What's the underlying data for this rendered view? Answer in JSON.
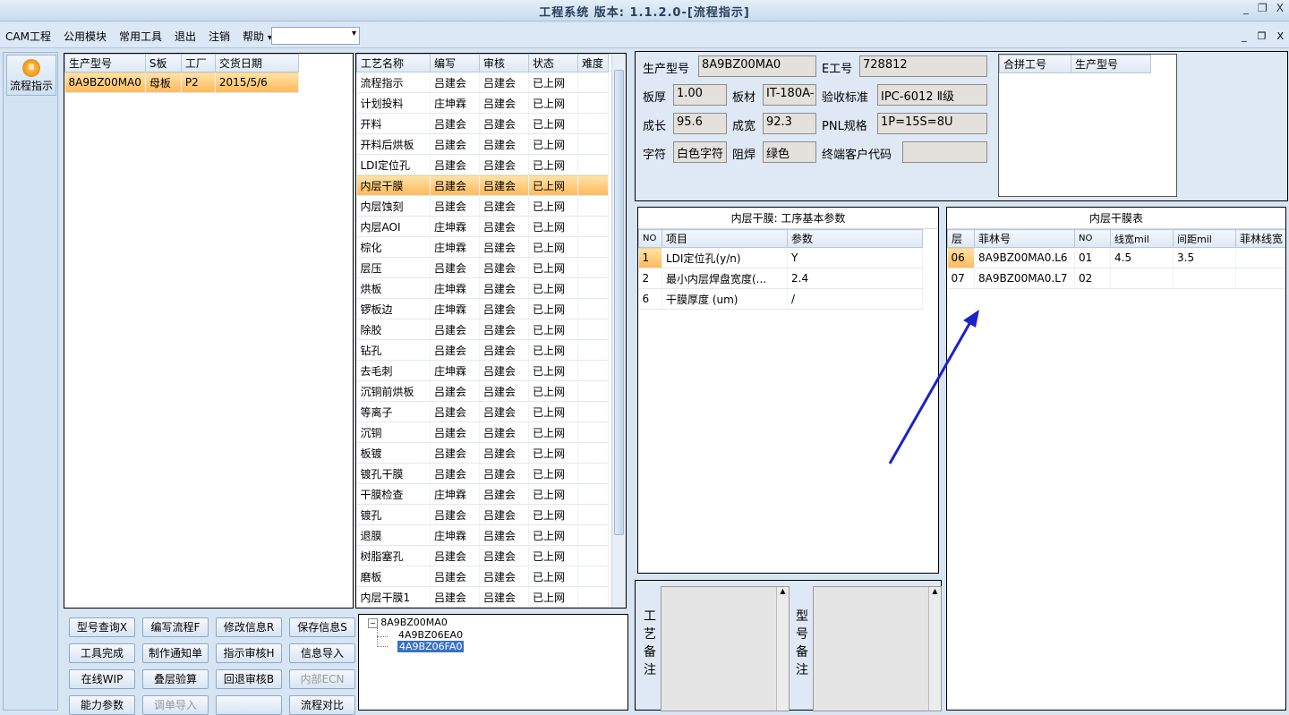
{
  "window": {
    "title": "工程系统 版本: 1.1.2.0-[流程指示]",
    "controls": [
      "_",
      "❐",
      "X"
    ]
  },
  "menu": {
    "items": [
      "CAM工程",
      "公用模块",
      "常用工具",
      "退出",
      "注销",
      "帮助"
    ],
    "help_arrow": "▾",
    "combo_value": ""
  },
  "child_controls": [
    "_",
    "❐",
    "X"
  ],
  "sidebar": {
    "flow_button": "流程指示"
  },
  "order_table": {
    "headers": [
      "生产型号",
      "S板",
      "工厂",
      "交货日期"
    ],
    "rows": [
      [
        "8A9BZ00MA0",
        "母板",
        "P2",
        "2015/5/6"
      ]
    ]
  },
  "process_table": {
    "headers": [
      "工艺名称",
      "编写",
      "审核",
      "状态",
      "难度"
    ],
    "rows": [
      [
        "流程指示",
        "吕建会",
        "吕建会",
        "已上网",
        ""
      ],
      [
        "计划投料",
        "庄坤霖",
        "吕建会",
        "已上网",
        ""
      ],
      [
        "开料",
        "吕建会",
        "吕建会",
        "已上网",
        ""
      ],
      [
        "开料后烘板",
        "吕建会",
        "吕建会",
        "已上网",
        ""
      ],
      [
        "LDI定位孔",
        "吕建会",
        "吕建会",
        "已上网",
        ""
      ],
      [
        "内层干膜",
        "吕建会",
        "吕建会",
        "已上网",
        ""
      ],
      [
        "内层蚀刻",
        "吕建会",
        "吕建会",
        "已上网",
        ""
      ],
      [
        "内层AOI",
        "庄坤霖",
        "吕建会",
        "已上网",
        ""
      ],
      [
        "棕化",
        "庄坤霖",
        "吕建会",
        "已上网",
        ""
      ],
      [
        "层压",
        "吕建会",
        "吕建会",
        "已上网",
        ""
      ],
      [
        "烘板",
        "庄坤霖",
        "吕建会",
        "已上网",
        ""
      ],
      [
        "锣板边",
        "庄坤霖",
        "吕建会",
        "已上网",
        ""
      ],
      [
        "除胶",
        "吕建会",
        "吕建会",
        "已上网",
        ""
      ],
      [
        "钻孔",
        "吕建会",
        "吕建会",
        "已上网",
        ""
      ],
      [
        "去毛刺",
        "庄坤霖",
        "吕建会",
        "已上网",
        ""
      ],
      [
        "沉铜前烘板",
        "吕建会",
        "吕建会",
        "已上网",
        ""
      ],
      [
        "等离子",
        "吕建会",
        "吕建会",
        "已上网",
        ""
      ],
      [
        "沉铜",
        "吕建会",
        "吕建会",
        "已上网",
        ""
      ],
      [
        "板镀",
        "吕建会",
        "吕建会",
        "已上网",
        ""
      ],
      [
        "镀孔干膜",
        "吕建会",
        "吕建会",
        "已上网",
        ""
      ],
      [
        "干膜检查",
        "庄坤霖",
        "吕建会",
        "已上网",
        ""
      ],
      [
        "镀孔",
        "吕建会",
        "吕建会",
        "已上网",
        ""
      ],
      [
        "退膜",
        "庄坤霖",
        "吕建会",
        "已上网",
        ""
      ],
      [
        "树脂塞孔",
        "吕建会",
        "吕建会",
        "已上网",
        ""
      ],
      [
        "磨板",
        "吕建会",
        "吕建会",
        "已上网",
        ""
      ],
      [
        "内层干膜1",
        "吕建会",
        "吕建会",
        "已上网",
        ""
      ]
    ],
    "selected_index": 5
  },
  "buttons": [
    [
      "型号查询X",
      "编写流程F",
      "修改信息R",
      "保存信息S"
    ],
    [
      "工具完成",
      "制作通知单",
      "指示审核H",
      "信息导入"
    ],
    [
      "在线WIP",
      "叠层验算",
      "回退审核B",
      "内部ECN"
    ],
    [
      "能力参数",
      "调单导入",
      "",
      "流程对比"
    ]
  ],
  "tree": {
    "root": "8A9BZ00MA0",
    "children": [
      "4A9BZ06EA0",
      "4A9BZ06FA0"
    ],
    "selected": "4A9BZ06FA0"
  },
  "info": {
    "prod_model_label": "生产型号",
    "prod_model": "8A9BZ00MA0",
    "e_no_label": "E工号",
    "e_no": "728812",
    "thickness_label": "板厚",
    "thickness": "1.00",
    "material_label": "板材",
    "material": "IT-180A-",
    "standard_label": "验收标准",
    "standard": "IPC-6012 Ⅱ级",
    "length_label": "成长",
    "length": "95.6",
    "width_label": "成宽",
    "width": "92.3",
    "pnl_label": "PNL规格",
    "pnl": "1P=15S=8U",
    "char_label": "字符",
    "char": "白色字符",
    "mask_label": "阻焊",
    "mask": "绿色",
    "customer_label": "终端客户代码",
    "customer": ""
  },
  "merge_table": {
    "headers": [
      "合拼工号",
      "生产型号"
    ]
  },
  "param_panel": {
    "title": "内层干膜: 工序基本参数",
    "headers": [
      "NO",
      "项目",
      "参数"
    ],
    "rows": [
      [
        "1",
        "LDI定位孔(y/n)",
        "Y"
      ],
      [
        "2",
        "最小内层焊盘宽度(...",
        "2.4"
      ],
      [
        "6",
        "干膜厚度 (um)",
        "/"
      ]
    ]
  },
  "film_panel": {
    "title": "内层干膜表",
    "headers": [
      "层",
      "菲林号",
      "NO",
      "线宽mil",
      "间距mil",
      "菲林线宽"
    ],
    "rows": [
      [
        "06",
        "8A9BZ00MA0.L6",
        "01",
        "4.5",
        "3.5",
        ""
      ],
      [
        "07",
        "8A9BZ00MA0.L7",
        "02",
        "",
        "",
        ""
      ]
    ]
  },
  "notes": {
    "process_label": [
      "工",
      "艺",
      "备",
      "注"
    ],
    "model_label": [
      "型",
      "号",
      "备",
      "注"
    ]
  },
  "colors": {
    "selection": "#ffb95a",
    "arrow": "#1a22c8",
    "background": "#d7e4f2"
  }
}
